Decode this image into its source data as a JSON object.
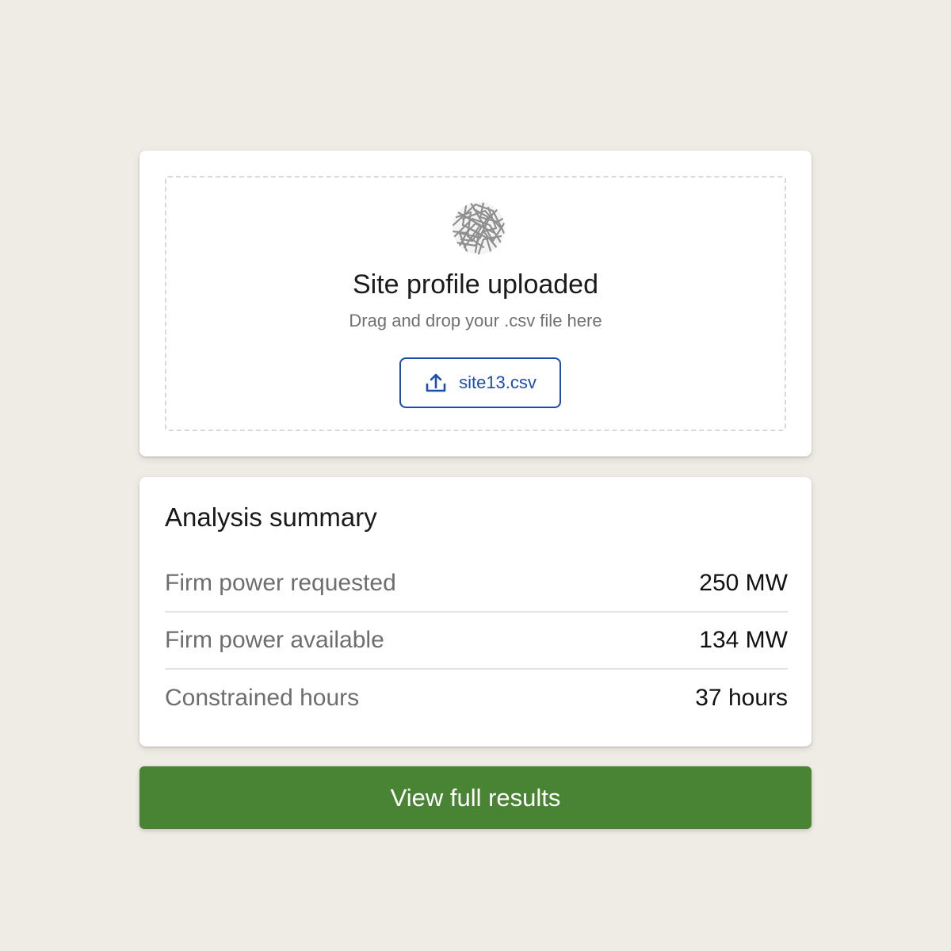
{
  "upload": {
    "title": "Site profile uploaded",
    "subtitle": "Drag and drop your .csv file here",
    "file_name": "site13.csv",
    "icons": [
      "profile-mesh-icon",
      "upload-icon"
    ]
  },
  "summary": {
    "title": "Analysis summary",
    "rows": [
      {
        "label": "Firm power requested",
        "value": "250 MW"
      },
      {
        "label": "Firm power available",
        "value": "134 MW"
      },
      {
        "label": "Constrained hours",
        "value": "37 hours"
      }
    ]
  },
  "actions": {
    "view_results_label": "View full results"
  },
  "colors": {
    "background": "#efebe5",
    "accent_blue": "#1d4dab",
    "primary_green": "#488434"
  }
}
